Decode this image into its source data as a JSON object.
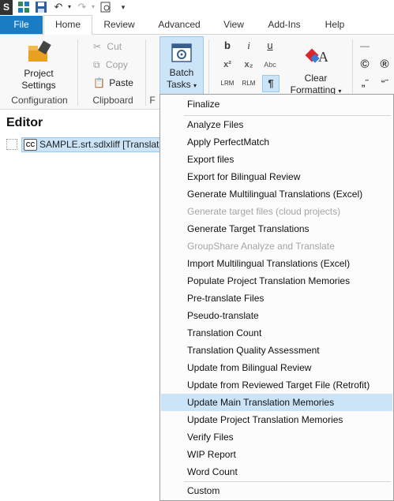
{
  "qat": {
    "logo": "S"
  },
  "tabs": [
    "File",
    "Home",
    "Review",
    "Advanced",
    "View",
    "Add-Ins",
    "Help"
  ],
  "ribbon": {
    "project_settings": [
      "Project",
      "Settings"
    ],
    "configuration_label": "Configuration",
    "cut": "Cut",
    "copy": "Copy",
    "paste": "Paste",
    "clipboard_label": "Clipboard",
    "f_label": "F",
    "batch_tasks": [
      "Batch",
      "Tasks"
    ],
    "clear_formatting": [
      "Clear",
      "Formatting"
    ],
    "format_icons": {
      "bold": "b",
      "italic": "i",
      "underline": "u",
      "superscript": "x²",
      "subscript": "x₂",
      "smallcaps": "Abc",
      "lrm": "LRM",
      "rlm": "RLM",
      "pilcrow": "¶",
      "copyright": "©",
      "registered": "®",
      "quote_left": "„˝",
      "quote_right": "“˝"
    }
  },
  "editor": {
    "title": "Editor",
    "file": "SAMPLE.srt.sdlxliff [Translation"
  },
  "menu": {
    "finalize": "Finalize",
    "items": [
      {
        "label": "Analyze Files",
        "enabled": true
      },
      {
        "label": "Apply PerfectMatch",
        "enabled": true
      },
      {
        "label": "Export files",
        "enabled": true
      },
      {
        "label": "Export for Bilingual Review",
        "enabled": true
      },
      {
        "label": "Generate Multilingual Translations (Excel)",
        "enabled": true
      },
      {
        "label": "Generate target files (cloud projects)",
        "enabled": false
      },
      {
        "label": "Generate Target Translations",
        "enabled": true
      },
      {
        "label": "GroupShare Analyze and Translate",
        "enabled": false
      },
      {
        "label": "Import Multilingual Translations (Excel)",
        "enabled": true
      },
      {
        "label": "Populate Project Translation Memories",
        "enabled": true
      },
      {
        "label": "Pre-translate Files",
        "enabled": true
      },
      {
        "label": "Pseudo-translate",
        "enabled": true
      },
      {
        "label": "Translation Count",
        "enabled": true
      },
      {
        "label": "Translation Quality Assessment",
        "enabled": true
      },
      {
        "label": "Update from Bilingual Review",
        "enabled": true
      },
      {
        "label": "Update from Reviewed Target File (Retrofit)",
        "enabled": true
      },
      {
        "label": "Update Main Translation Memories",
        "enabled": true,
        "highlighted": true
      },
      {
        "label": "Update Project Translation Memories",
        "enabled": true
      },
      {
        "label": "Verify Files",
        "enabled": true
      },
      {
        "label": "WIP Report",
        "enabled": true
      },
      {
        "label": "Word Count",
        "enabled": true
      }
    ],
    "custom": "Custom"
  },
  "colors": {
    "accent": "#1a7dc4",
    "highlight": "#cce4f7",
    "disabled": "#a5a5a5"
  }
}
